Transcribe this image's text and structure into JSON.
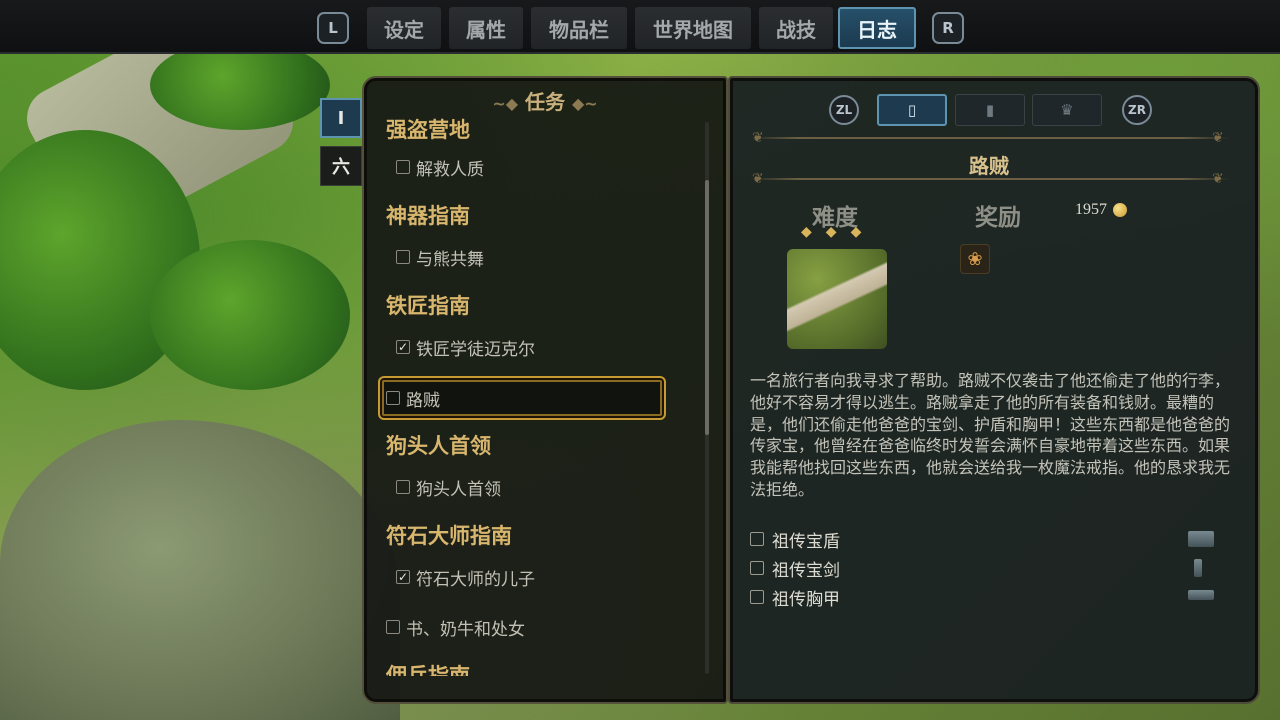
{
  "top_nav": {
    "left_shoulder": "L",
    "right_shoulder": "R",
    "tabs": [
      {
        "label": "设定",
        "active": false
      },
      {
        "label": "属性",
        "active": false
      },
      {
        "label": "物品栏",
        "active": false
      },
      {
        "label": "世界地图",
        "active": false
      },
      {
        "label": "战技",
        "active": false
      },
      {
        "label": "日志",
        "active": true
      }
    ]
  },
  "side_tabs": [
    {
      "label": "I",
      "active": true
    },
    {
      "label": "六",
      "active": false
    }
  ],
  "quest_panel": {
    "heading": "任务",
    "groups": [
      {
        "title": "强盗营地",
        "items": [
          {
            "label": "解救人质",
            "checked": false
          }
        ]
      },
      {
        "title": "神器指南",
        "items": [
          {
            "label": "与熊共舞",
            "checked": false
          }
        ]
      },
      {
        "title": "铁匠指南",
        "items": [
          {
            "label": "铁匠学徒迈克尔",
            "checked": true
          }
        ]
      },
      {
        "title": "",
        "items": [
          {
            "label": "路贼",
            "checked": false,
            "selected": true
          }
        ]
      },
      {
        "title": "狗头人首领",
        "items": [
          {
            "label": "狗头人首领",
            "checked": false
          }
        ]
      },
      {
        "title": "符石大师指南",
        "items": [
          {
            "label": "符石大师的儿子",
            "checked": true
          }
        ]
      },
      {
        "title": "",
        "items": [
          {
            "label": "书、奶牛和处女",
            "checked": false
          }
        ]
      },
      {
        "title": "佣兵指南",
        "items": []
      }
    ]
  },
  "detail_panel": {
    "left_trigger": "ZL",
    "right_trigger": "ZR",
    "sub_tabs": [
      {
        "icon": "scroll-icon",
        "active": true
      },
      {
        "icon": "book-icon",
        "active": false
      },
      {
        "icon": "crown-icon",
        "active": false
      }
    ],
    "title": "路贼",
    "difficulty_label": "难度",
    "difficulty_stars": 3,
    "reward_label": "奖励",
    "gold_amount": "1957",
    "reward_item_icon": "ring-pouch-icon",
    "description": "一名旅行者向我寻求了帮助。路贼不仅袭击了他还偷走了他的行李，他好不容易才得以逃生。路贼拿走了他的所有装备和钱财。最糟的是，他们还偷走他爸爸的宝剑、护盾和胸甲！这些东西都是他爸爸的传家宝，他曾经在爸爸临终时发誓会满怀自豪地带着这些东西。如果我能帮他找回这些东西，他就会送给我一枚魔法戒指。他的恳求我无法拒绝。",
    "objectives": [
      {
        "label": "祖传宝盾",
        "checked": false,
        "icon": "shield-icon"
      },
      {
        "label": "祖传宝剑",
        "checked": false,
        "icon": "sword-icon"
      },
      {
        "label": "祖传胸甲",
        "checked": false,
        "icon": "chestplate-icon"
      }
    ]
  }
}
